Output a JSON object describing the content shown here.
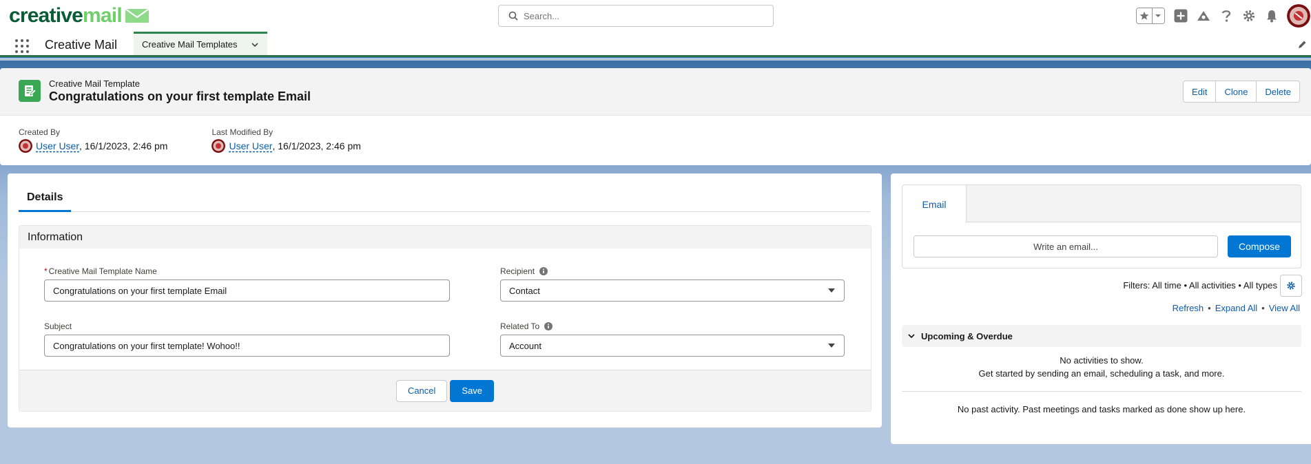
{
  "brand": {
    "logo_part1": "creative",
    "logo_part2": "mail",
    "primary_color": "#0a5c36",
    "accent_color": "#6fcf6a"
  },
  "global_header": {
    "search_placeholder": "Search...",
    "icons": [
      "star-icon",
      "chevron-down-icon",
      "plus-icon",
      "trailhead-icon",
      "help-icon",
      "gear-icon",
      "bell-icon",
      "avatar"
    ]
  },
  "app_nav": {
    "app_name": "Creative Mail",
    "tab_label": "Creative Mail Templates"
  },
  "record": {
    "object_type": "Creative Mail Template",
    "title": "Congratulations on your first template Email",
    "actions": [
      "Edit",
      "Clone",
      "Delete"
    ],
    "highlights": [
      {
        "label": "Created By",
        "user": "User User",
        "timestamp": ", 16/1/2023, 2:46 pm"
      },
      {
        "label": "Last Modified By",
        "user": "User User",
        "timestamp": ", 16/1/2023, 2:46 pm"
      }
    ]
  },
  "details": {
    "tab_label": "Details",
    "section_title": "Information",
    "fields": {
      "template_name": {
        "required_mark": "*",
        "label": "Creative Mail Template Name",
        "value": "Congratulations on your first template Email"
      },
      "recipient": {
        "label": "Recipient",
        "value": "Contact"
      },
      "subject": {
        "label": "Subject",
        "value": "Congratulations on your first template! Wohoo!!"
      },
      "related_to": {
        "label": "Related To",
        "value": "Account"
      }
    },
    "cancel_label": "Cancel",
    "save_label": "Save"
  },
  "activity": {
    "tab_label": "Email",
    "write_placeholder": "Write an email...",
    "compose_label": "Compose",
    "filters_text": "Filters: All time • All activities • All types",
    "links": {
      "refresh": "Refresh",
      "expand_all": "Expand All",
      "view_all": "View All",
      "separator": "•"
    },
    "upcoming_label": "Upcoming & Overdue",
    "no_activities": "No activities to show.",
    "get_started": "Get started by sending an email, scheduling a task, and more.",
    "no_past": "No past activity. Past meetings and tasks marked as done show up here."
  }
}
